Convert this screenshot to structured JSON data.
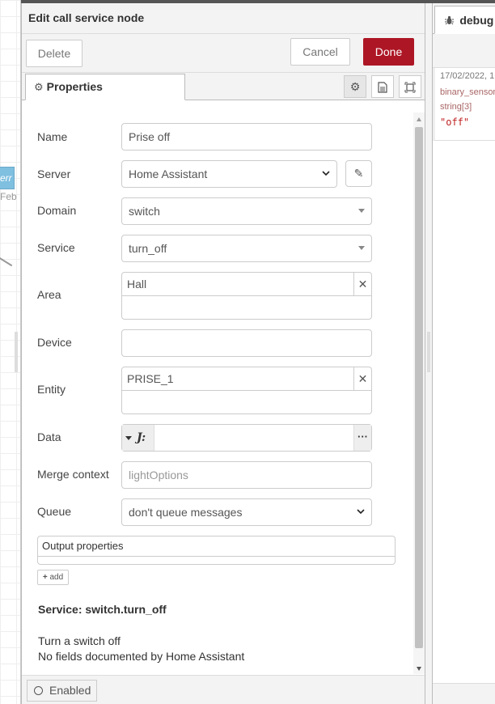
{
  "editor": {
    "title": "Edit call service node",
    "delete_label": "Delete",
    "cancel_label": "Cancel",
    "done_label": "Done",
    "tab_properties": "Properties",
    "footer_enabled": "Enabled"
  },
  "canvas": {
    "node_label": "err",
    "node_sublabel": "Feb"
  },
  "form": {
    "name_label": "Name",
    "name_value": "Prise off",
    "server_label": "Server",
    "server_value": "Home Assistant",
    "domain_label": "Domain",
    "domain_value": "switch",
    "service_label": "Service",
    "service_value": "turn_off",
    "area_label": "Area",
    "area_value": "Hall",
    "device_label": "Device",
    "device_value": "",
    "entity_label": "Entity",
    "entity_value": "PRISE_1",
    "data_label": "Data",
    "data_type_icon": "J:",
    "data_value": "",
    "merge_label": "Merge context",
    "merge_placeholder": "lightOptions",
    "queue_label": "Queue",
    "queue_value": "don't queue messages",
    "output_props_label": "Output properties",
    "add_label": "add",
    "service_title": "Service: switch.turn_off",
    "service_desc_1": "Turn a switch off",
    "service_desc_2": "No fields documented by Home Assistant"
  },
  "debug": {
    "tab_label": "debug",
    "msg_date": "17/02/2022, 1",
    "msg_topic": "binary_sensor",
    "msg_type": "string[3]",
    "msg_value": "\"off\""
  },
  "colors": {
    "done_button": "#ad1625",
    "panel_bg": "#f3f3f3"
  }
}
